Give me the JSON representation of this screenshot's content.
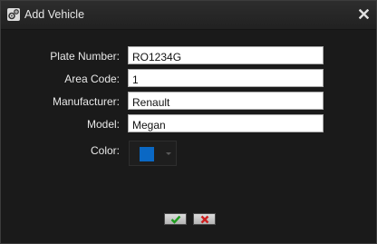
{
  "window": {
    "title": "Add Vehicle",
    "title_icon": "gears-icon",
    "close_icon": "close-icon"
  },
  "form": {
    "plate_number": {
      "label": "Plate Number:",
      "value": "RO1234G"
    },
    "area_code": {
      "label": "Area Code:",
      "value": "1"
    },
    "manufacturer": {
      "label": "Manufacturer:",
      "value": "Renault"
    },
    "model": {
      "label": "Model:",
      "value": "Megan"
    },
    "color": {
      "label": "Color:",
      "value": "#0a68c4"
    }
  },
  "actions": {
    "confirm_icon": "check-icon",
    "cancel_icon": "x-icon",
    "confirm_color": "#1f9c1f",
    "cancel_color": "#cc1f1f"
  },
  "theme": {
    "background": "#1a1a1a",
    "titlebar": "#262626",
    "label_text": "#e8e8e8"
  }
}
